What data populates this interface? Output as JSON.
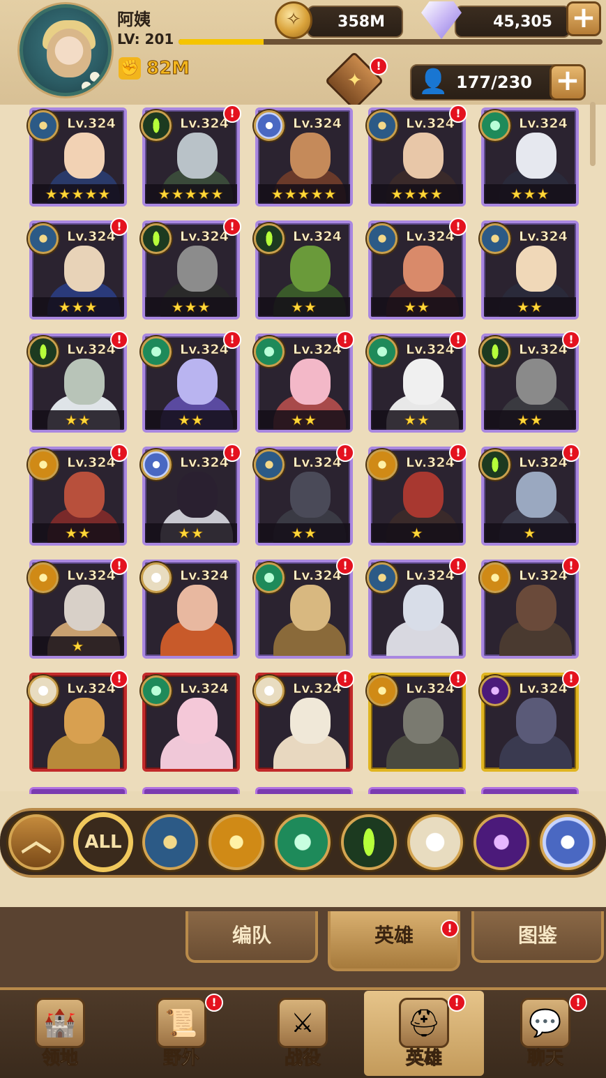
{
  "player": {
    "name": "阿姨",
    "level_label": "LV: 201",
    "xp_fraction": 0.2,
    "power": "82M"
  },
  "resources": {
    "gold": "358M",
    "gems": "45,305",
    "roster": "177/230",
    "plus_label": "+"
  },
  "icons": {
    "fist": "fist-icon",
    "gold": "gold-coin-icon",
    "gem": "diamond-icon",
    "person": "person-icon",
    "chest": "chest-icon"
  },
  "badge_label": "!",
  "heroes": [
    {
      "lv": "Lv.324",
      "faction": "lightbearer",
      "stars": "★★★★★",
      "frame": "purple",
      "alert": false,
      "winged": true
    },
    {
      "lv": "Lv.324",
      "faction": "wilder-eye",
      "stars": "★★★★★",
      "frame": "purple",
      "alert": true
    },
    {
      "lv": "Lv.324",
      "faction": "celestial-shield",
      "stars": "★★★★★",
      "frame": "purple",
      "alert": false
    },
    {
      "lv": "Lv.324",
      "faction": "lightbearer",
      "stars": "★★★★",
      "frame": "purple",
      "alert": true
    },
    {
      "lv": "Lv.324",
      "faction": "wilder",
      "stars": "★★★",
      "frame": "purple",
      "alert": false
    },
    {
      "lv": "Lv.324",
      "faction": "lightbearer",
      "stars": "★★★",
      "frame": "purple",
      "alert": true
    },
    {
      "lv": "Lv.324",
      "faction": "wilder-eye",
      "stars": "★★★",
      "frame": "purple",
      "alert": true
    },
    {
      "lv": "Lv.324",
      "faction": "wilder-eye",
      "stars": "★★",
      "frame": "purple",
      "alert": false,
      "winged": true
    },
    {
      "lv": "Lv.324",
      "faction": "lightbearer",
      "stars": "★★",
      "frame": "purple",
      "alert": true
    },
    {
      "lv": "Lv.324",
      "faction": "lightbearer",
      "stars": "★★",
      "frame": "purple",
      "alert": false
    },
    {
      "lv": "Lv.324",
      "faction": "wilder-eye",
      "stars": "★★",
      "frame": "purple",
      "alert": true
    },
    {
      "lv": "Lv.324",
      "faction": "wilder",
      "stars": "★★",
      "frame": "purple",
      "alert": true
    },
    {
      "lv": "Lv.324",
      "faction": "wilder",
      "stars": "★★",
      "frame": "purple",
      "alert": true
    },
    {
      "lv": "Lv.324",
      "faction": "wilder",
      "stars": "★★",
      "frame": "purple",
      "alert": true
    },
    {
      "lv": "Lv.324",
      "faction": "wilder-eye",
      "stars": "★★",
      "frame": "purple",
      "alert": true
    },
    {
      "lv": "Lv.324",
      "faction": "mauler",
      "stars": "★★",
      "frame": "purple",
      "alert": true
    },
    {
      "lv": "Lv.324",
      "faction": "celestial-shield",
      "stars": "★★",
      "frame": "purple",
      "alert": true
    },
    {
      "lv": "Lv.324",
      "faction": "lightbearer",
      "stars": "★★",
      "frame": "purple",
      "alert": true
    },
    {
      "lv": "Lv.324",
      "faction": "mauler",
      "stars": "★",
      "frame": "purple",
      "alert": true
    },
    {
      "lv": "Lv.324",
      "faction": "wilder-eye",
      "stars": "★",
      "frame": "purple",
      "alert": true
    },
    {
      "lv": "Lv.324",
      "faction": "mauler",
      "stars": "★",
      "frame": "purple",
      "alert": true
    },
    {
      "lv": "Lv.324",
      "faction": "celestial",
      "stars": "",
      "frame": "purple",
      "alert": false
    },
    {
      "lv": "Lv.324",
      "faction": "wilder",
      "stars": "",
      "frame": "purple",
      "alert": true
    },
    {
      "lv": "Lv.324",
      "faction": "lightbearer",
      "stars": "",
      "frame": "purple",
      "alert": true
    },
    {
      "lv": "Lv.324",
      "faction": "mauler",
      "stars": "",
      "frame": "purple",
      "alert": true
    },
    {
      "lv": "Lv.324",
      "faction": "celestial",
      "stars": "",
      "frame": "red",
      "alert": true
    },
    {
      "lv": "Lv.324",
      "faction": "wilder",
      "stars": "",
      "frame": "red",
      "alert": false
    },
    {
      "lv": "Lv.324",
      "faction": "celestial",
      "stars": "",
      "frame": "red",
      "alert": true
    },
    {
      "lv": "Lv.324",
      "faction": "mauler",
      "stars": "",
      "frame": "gold",
      "alert": true
    },
    {
      "lv": "Lv.324",
      "faction": "hypogean",
      "stars": "",
      "frame": "gold",
      "alert": true
    }
  ],
  "filters": {
    "collapse_label": "︿",
    "all_label": "ALL",
    "factions": [
      "lightbearer-filter-icon",
      "mauler-filter-icon",
      "wilder-filter-icon",
      "graveborn-filter-icon",
      "celestial-filter-icon",
      "hypogean-filter-icon",
      "dimensional-filter-icon"
    ]
  },
  "subtabs": [
    {
      "label": "编队",
      "active": false,
      "alert": false
    },
    {
      "label": "英雄",
      "active": true,
      "alert": true
    },
    {
      "label": "图鉴",
      "active": false,
      "alert": false
    }
  ],
  "nav": [
    {
      "label": "领地",
      "icon": "castle-icon",
      "active": false,
      "alert": false
    },
    {
      "label": "野外",
      "icon": "map-scroll-icon",
      "active": false,
      "alert": true
    },
    {
      "label": "战役",
      "icon": "campaign-sword-icon",
      "active": false,
      "alert": false
    },
    {
      "label": "英雄",
      "icon": "hero-helmet-icon",
      "active": true,
      "alert": true
    },
    {
      "label": "聊天",
      "icon": "chat-bubble-icon",
      "active": false,
      "alert": true
    }
  ],
  "colors": {
    "frame_purple": "#a987e0",
    "frame_red": "#c22a2a",
    "frame_gold": "#e0b520",
    "alert_red": "#e4121f",
    "accent_gold": "#f2b51c"
  }
}
